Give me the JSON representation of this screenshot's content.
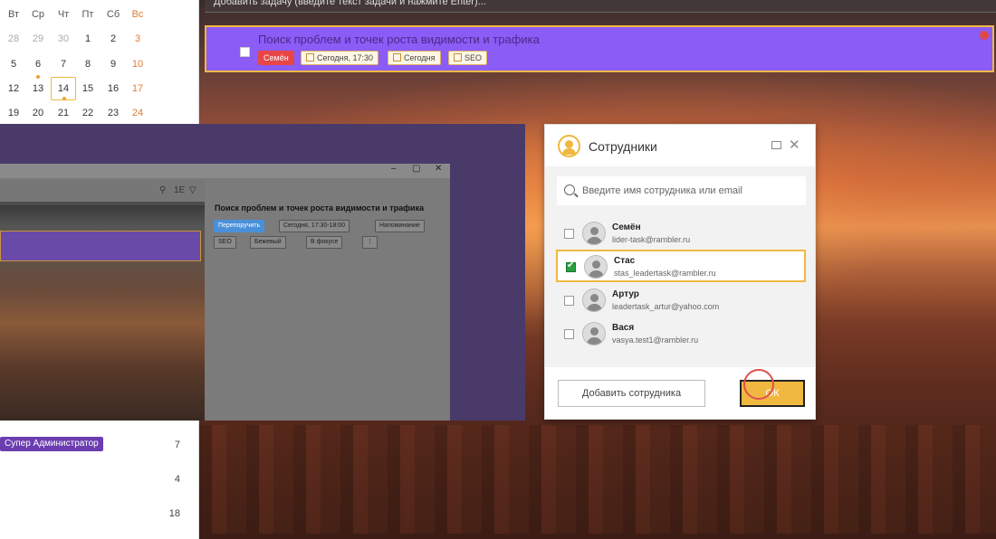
{
  "calendar": {
    "weekdays": [
      "Вт",
      "Ср",
      "Чт",
      "Пт",
      "Сб",
      "Вс"
    ],
    "rows": [
      [
        "28",
        "29",
        "30",
        "1",
        "2",
        "3"
      ],
      [
        "5",
        "6",
        "7",
        "8",
        "9",
        "10"
      ],
      [
        "12",
        "13",
        "14",
        "15",
        "16",
        "17"
      ],
      [
        "19",
        "20",
        "21",
        "22",
        "23",
        "24"
      ]
    ]
  },
  "sidebar": {
    "role_badge": "Супер Администратор",
    "counts": [
      "7",
      "4",
      "18"
    ]
  },
  "task_input": {
    "placeholder": "Добавить задачу (введите текст задачи и нажмите Enter)..."
  },
  "task": {
    "title": "Поиск проблем и точек роста видимости и трафика",
    "assignee": "Семён",
    "datetime": "Сегодня, 17:30",
    "date": "Сегодня",
    "project": "SEO"
  },
  "inner_window": {
    "title": "Поиск проблем и точек роста видимости и трафика",
    "buttons_row1": [
      "Перепоручить",
      "Сегодня, 17:30-18:00",
      "Напоминание"
    ],
    "buttons_row2": [
      "SEO",
      "Бежевый",
      "В фокусе"
    ],
    "toolbar_label": "1E"
  },
  "dialog": {
    "title": "Сотрудники",
    "search_placeholder": "Введите имя сотрудника или email",
    "employees": [
      {
        "name": "Семён",
        "email": "lider-task@rambler.ru",
        "checked": false
      },
      {
        "name": "Стас",
        "email": "stas_leadertask@rambler.ru",
        "checked": true
      },
      {
        "name": "Артур",
        "email": "leadertask_artur@yahoo.com",
        "checked": false
      },
      {
        "name": "Вася",
        "email": "vasya.test1@rambler.ru",
        "checked": false
      }
    ],
    "add_button": "Добавить сотрудника",
    "ok_button": "ОК"
  },
  "colors": {
    "accent": "#f0b840",
    "purple": "#8b5cf6",
    "red": "#e84545"
  }
}
